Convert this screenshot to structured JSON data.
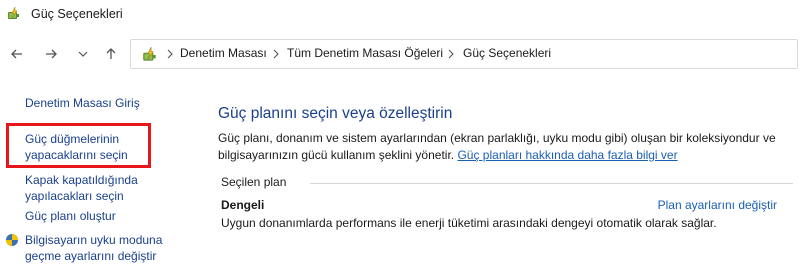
{
  "window": {
    "title": "Güç Seçenekleri",
    "title_icon": "power-options-icon"
  },
  "nav": {
    "back_icon": "back-arrow-icon",
    "forward_icon": "forward-arrow-icon",
    "recent_icon": "chevron-down-icon",
    "up_icon": "up-arrow-icon"
  },
  "address": {
    "icon": "power-options-icon",
    "crumbs": [
      "Denetim Masası",
      "Tüm Denetim Masası Öğeleri",
      "Güç Seçenekleri"
    ]
  },
  "sidebar": {
    "items": [
      {
        "label": "Denetim Masası Giriş"
      },
      {
        "label_line1": "Güç düğmelerinin",
        "label_line2": "yapacaklarını seçin"
      },
      {
        "label_line1": "Kapak kapatıldığında",
        "label_line2": "yapılacakları seçin"
      },
      {
        "label": "Güç planı oluştur"
      },
      {
        "label_line1": "Bilgisayarın uyku moduna",
        "label_line2": "geçme ayarlarını değiştir",
        "icon": "shield-icon"
      }
    ],
    "highlight_color": "#e6161b"
  },
  "main": {
    "title": "Güç planını seçin veya özelleştirin",
    "description_line1": "Güç planı, donanım ve sistem ayarlarından (ekran parlaklığı, uyku modu gibi) oluşan bir koleksiyondur ve",
    "description_line2": "bilgisayarınızın gücü kullanım şeklini yönetir.",
    "learn_more_link": "Güç planları hakkında daha fazla bilgi ver",
    "section_label": "Seçilen plan",
    "plan": {
      "name": "Dengeli",
      "change_link": "Plan ayarlarını değiştir",
      "description": "Uygun donanımlarda performans ile enerji tüketimi arasındaki dengeyi otomatik olarak sağlar."
    }
  },
  "colors": {
    "link": "#1a5fb4",
    "title": "#1a3f8c",
    "highlight": "#e6161b"
  }
}
